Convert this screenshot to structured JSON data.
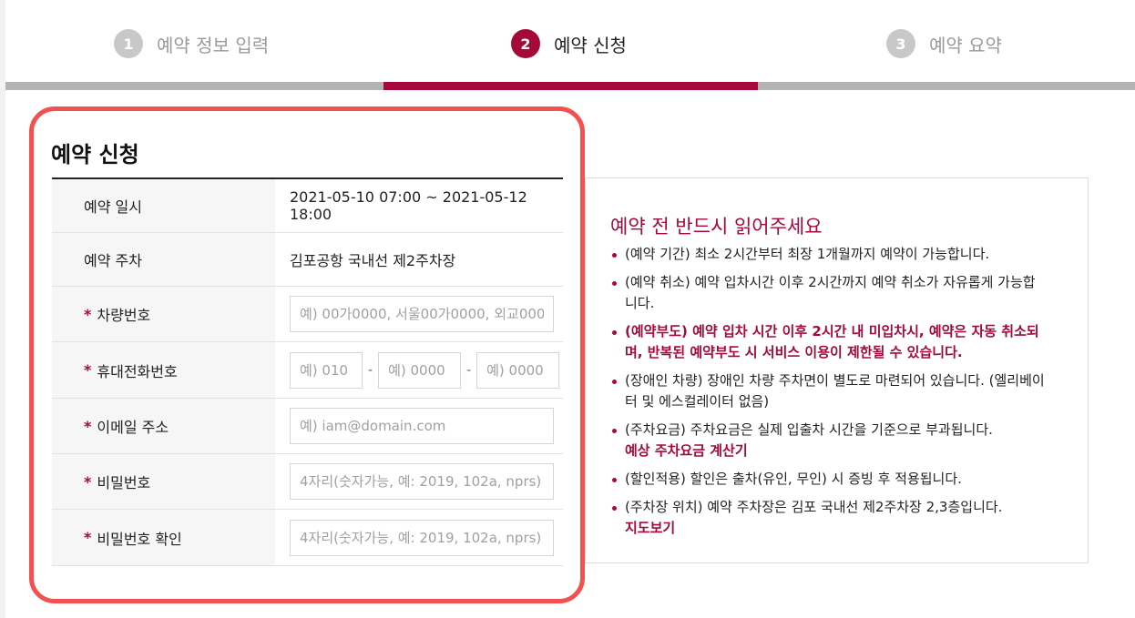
{
  "steps": [
    {
      "num": "1",
      "label": "예약 정보 입력"
    },
    {
      "num": "2",
      "label": "예약 신청"
    },
    {
      "num": "3",
      "label": "예약 요약"
    }
  ],
  "form": {
    "title": "예약 신청",
    "required_mark": "*",
    "rows": {
      "datetime": {
        "label": "예약 일시",
        "value": "2021-05-10 07:00 ~ 2021-05-12 18:00"
      },
      "parking": {
        "label": "예약 주차",
        "value": "김포공항 국내선 제2주차장"
      },
      "car": {
        "label": "차량번호",
        "placeholder": "예) 00가0000, 서울00가0000, 외교0000"
      },
      "phone": {
        "label": "휴대전화번호",
        "p1": "예) 010",
        "p2": "예) 0000",
        "p3": "예) 0000",
        "sep": "-"
      },
      "email": {
        "label": "이메일 주소",
        "placeholder": "예) iam@domain.com"
      },
      "password": {
        "label": "비밀번호",
        "placeholder": "4자리(숫자가능, 예: 2019, 102a, nprs)"
      },
      "password_confirm": {
        "label": "비밀번호 확인",
        "placeholder": "4자리(숫자가능, 예: 2019, 102a, nprs)"
      }
    }
  },
  "notice": {
    "title": "예약 전 반드시 읽어주세요",
    "items": [
      "(예약 기간) 최소 2시간부터 최장 1개월까지 예약이 가능합니다.",
      "(예약 취소) 예약 입차시간 이후 2시간까지 예약 취소가 자유롭게 가능합니다.",
      "(예약부도) 예약 입차 시간 이후 2시간 내 미입차시, 예약은 자동 취소되며, 반복된 예약부도 시 서비스 이용이 제한될 수 있습니다.",
      "(장애인 차량) 장애인 차량 주차면이 별도로 마련되어 있습니다. (엘리베이터 및 에스컬레이터 없음)",
      "(주차요금) 주차요금은 실제 입출차 시간을 기준으로 부과됩니다.",
      "(할인적용) 할인은 출차(유인, 무인) 시 증빙 후 적용됩니다.",
      "(주차장 위치) 예약 주차장은 김포 국내선 제2주차장 2,3층입니다."
    ],
    "fee_link": "예상 주차요금 계산기",
    "map_link": "지도보기"
  },
  "colors": {
    "accent": "#a5093a",
    "highlight_border": "#f2514f",
    "inactive": "#b3b3b3"
  }
}
